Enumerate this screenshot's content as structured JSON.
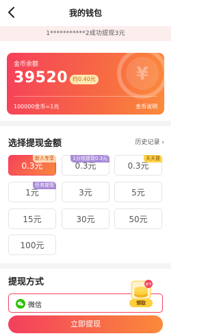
{
  "header": {
    "title": "我的钱包"
  },
  "notice": {
    "text": "1***********2成功提现3元"
  },
  "balance": {
    "label": "金币余额",
    "amount": "39520",
    "approx": "约0.40元",
    "rate": "100000金币=1元",
    "explain": "金币说明",
    "coin_symbol": "¥"
  },
  "withdraw": {
    "title": "选择提现金额",
    "history": "历史记录 ›",
    "options": [
      {
        "label": "0.3元",
        "badge": "新人专享"
      },
      {
        "label": "0.3元",
        "badge": "1分钱提现0.3元"
      },
      {
        "label": "0.3元",
        "badge": "天天提"
      },
      {
        "label": "1元",
        "badge": "任务提现"
      },
      {
        "label": "3元",
        "badge": ""
      },
      {
        "label": "5元",
        "badge": ""
      },
      {
        "label": "15元",
        "badge": ""
      },
      {
        "label": "30元",
        "badge": ""
      },
      {
        "label": "50元",
        "badge": ""
      },
      {
        "label": "100元",
        "badge": ""
      }
    ]
  },
  "method": {
    "title": "提现方式",
    "selected": "微信"
  },
  "float_widget": {
    "label": "领取",
    "tag": "金币"
  },
  "submit": {
    "label": "立即提现"
  },
  "colors": {
    "accent": "#f5405a",
    "accent2": "#fb8a3a",
    "wechat": "#2dc100"
  }
}
